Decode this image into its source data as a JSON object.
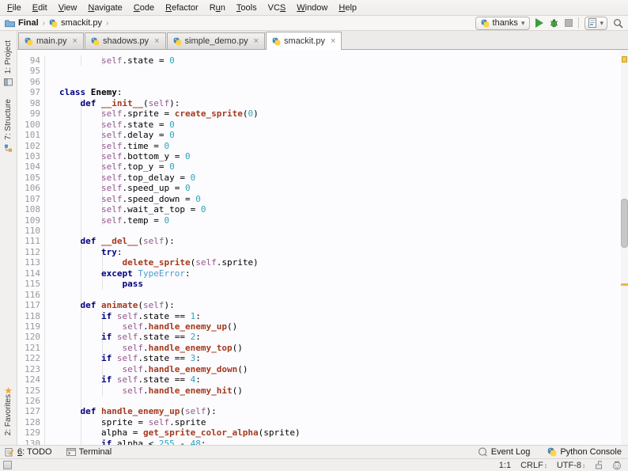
{
  "menu": {
    "items": [
      {
        "label": "File",
        "m": 0
      },
      {
        "label": "Edit",
        "m": 0
      },
      {
        "label": "View",
        "m": 0
      },
      {
        "label": "Navigate",
        "m": 0
      },
      {
        "label": "Code",
        "m": 0
      },
      {
        "label": "Refactor",
        "m": 0
      },
      {
        "label": "Run",
        "m": 1
      },
      {
        "label": "Tools",
        "m": 0
      },
      {
        "label": "VCS",
        "m": 2
      },
      {
        "label": "Window",
        "m": 0
      },
      {
        "label": "Help",
        "m": 0
      }
    ]
  },
  "breadcrumb": {
    "items": [
      {
        "label": "Final",
        "icon": "folder-icon",
        "bold": true
      },
      {
        "label": "smackit.py",
        "icon": "python-file-icon",
        "bold": false
      }
    ]
  },
  "toolbar": {
    "run_config_label": "thanks"
  },
  "tabs": [
    {
      "label": "main.py",
      "icon": "python-file-icon",
      "close": "×",
      "active": false
    },
    {
      "label": "shadows.py",
      "icon": "python-file-icon",
      "close": "×",
      "active": false
    },
    {
      "label": "simple_demo.py",
      "icon": "python-file-icon",
      "close": "×",
      "active": false
    },
    {
      "label": "smackit.py",
      "icon": "python-file-icon",
      "close": "×",
      "active": true
    }
  ],
  "left_stripe": {
    "project": "1: Project",
    "structure": "7: Structure",
    "favorites": "2: Favorites"
  },
  "colors": {
    "keyword": "#000080",
    "self": "#94558D",
    "function": "#A5391E",
    "number": "#2EA3BE",
    "exception": "#4C9CC9",
    "warn_stripe": "#F5C944"
  },
  "editor": {
    "lines": [
      {
        "n": 94,
        "t": [
          [
            "p",
            "        "
          ],
          [
            "s",
            "self"
          ],
          [
            "p",
            ".state = "
          ],
          [
            "n",
            "0"
          ]
        ]
      },
      {
        "n": 95,
        "t": []
      },
      {
        "n": 96,
        "t": []
      },
      {
        "n": 97,
        "t": [
          [
            "k",
            "class "
          ],
          [
            "c",
            "Enemy"
          ],
          [
            "p",
            ":"
          ]
        ]
      },
      {
        "n": 98,
        "t": [
          [
            "p",
            "    "
          ],
          [
            "k",
            "def "
          ],
          [
            "f",
            "__init__"
          ],
          [
            "p",
            "("
          ],
          [
            "s",
            "self"
          ],
          [
            "p",
            "):"
          ]
        ]
      },
      {
        "n": 99,
        "t": [
          [
            "p",
            "        "
          ],
          [
            "s",
            "self"
          ],
          [
            "p",
            ".sprite = "
          ],
          [
            "f",
            "create_sprite"
          ],
          [
            "p",
            "("
          ],
          [
            "n",
            "0"
          ],
          [
            "p",
            ")"
          ]
        ]
      },
      {
        "n": 100,
        "t": [
          [
            "p",
            "        "
          ],
          [
            "s",
            "self"
          ],
          [
            "p",
            ".state = "
          ],
          [
            "n",
            "0"
          ]
        ]
      },
      {
        "n": 101,
        "t": [
          [
            "p",
            "        "
          ],
          [
            "s",
            "self"
          ],
          [
            "p",
            ".delay = "
          ],
          [
            "n",
            "0"
          ]
        ]
      },
      {
        "n": 102,
        "t": [
          [
            "p",
            "        "
          ],
          [
            "s",
            "self"
          ],
          [
            "p",
            ".time = "
          ],
          [
            "n",
            "0"
          ]
        ]
      },
      {
        "n": 103,
        "t": [
          [
            "p",
            "        "
          ],
          [
            "s",
            "self"
          ],
          [
            "p",
            ".bottom_y = "
          ],
          [
            "n",
            "0"
          ]
        ]
      },
      {
        "n": 104,
        "t": [
          [
            "p",
            "        "
          ],
          [
            "s",
            "self"
          ],
          [
            "p",
            ".top_y = "
          ],
          [
            "n",
            "0"
          ]
        ]
      },
      {
        "n": 105,
        "t": [
          [
            "p",
            "        "
          ],
          [
            "s",
            "self"
          ],
          [
            "p",
            ".top_delay = "
          ],
          [
            "n",
            "0"
          ]
        ]
      },
      {
        "n": 106,
        "t": [
          [
            "p",
            "        "
          ],
          [
            "s",
            "self"
          ],
          [
            "p",
            ".speed_up = "
          ],
          [
            "n",
            "0"
          ]
        ]
      },
      {
        "n": 107,
        "t": [
          [
            "p",
            "        "
          ],
          [
            "s",
            "self"
          ],
          [
            "p",
            ".speed_down = "
          ],
          [
            "n",
            "0"
          ]
        ]
      },
      {
        "n": 108,
        "t": [
          [
            "p",
            "        "
          ],
          [
            "s",
            "self"
          ],
          [
            "p",
            ".wait_at_top = "
          ],
          [
            "n",
            "0"
          ]
        ]
      },
      {
        "n": 109,
        "t": [
          [
            "p",
            "        "
          ],
          [
            "s",
            "self"
          ],
          [
            "p",
            ".temp = "
          ],
          [
            "n",
            "0"
          ]
        ]
      },
      {
        "n": 110,
        "t": []
      },
      {
        "n": 111,
        "t": [
          [
            "p",
            "    "
          ],
          [
            "k",
            "def "
          ],
          [
            "f",
            "__del__"
          ],
          [
            "p",
            "("
          ],
          [
            "s",
            "self"
          ],
          [
            "p",
            "):"
          ]
        ]
      },
      {
        "n": 112,
        "t": [
          [
            "p",
            "        "
          ],
          [
            "k",
            "try"
          ],
          [
            "p",
            ":"
          ]
        ]
      },
      {
        "n": 113,
        "t": [
          [
            "p",
            "            "
          ],
          [
            "f",
            "delete_sprite"
          ],
          [
            "p",
            "("
          ],
          [
            "s",
            "self"
          ],
          [
            "p",
            ".sprite)"
          ]
        ]
      },
      {
        "n": 114,
        "t": [
          [
            "p",
            "        "
          ],
          [
            "k",
            "except "
          ],
          [
            "e",
            "TypeError"
          ],
          [
            "p",
            ":"
          ]
        ]
      },
      {
        "n": 115,
        "t": [
          [
            "p",
            "            "
          ],
          [
            "k",
            "pass"
          ]
        ]
      },
      {
        "n": 116,
        "t": []
      },
      {
        "n": 117,
        "t": [
          [
            "p",
            "    "
          ],
          [
            "k",
            "def "
          ],
          [
            "f",
            "animate"
          ],
          [
            "p",
            "("
          ],
          [
            "s",
            "self"
          ],
          [
            "p",
            "):"
          ]
        ]
      },
      {
        "n": 118,
        "t": [
          [
            "p",
            "        "
          ],
          [
            "k",
            "if "
          ],
          [
            "s",
            "self"
          ],
          [
            "p",
            ".state == "
          ],
          [
            "n",
            "1"
          ],
          [
            "p",
            ":"
          ]
        ]
      },
      {
        "n": 119,
        "t": [
          [
            "p",
            "            "
          ],
          [
            "s",
            "self"
          ],
          [
            "p",
            "."
          ],
          [
            "f",
            "handle_enemy_up"
          ],
          [
            "p",
            "()"
          ]
        ]
      },
      {
        "n": 120,
        "t": [
          [
            "p",
            "        "
          ],
          [
            "k",
            "if "
          ],
          [
            "s",
            "self"
          ],
          [
            "p",
            ".state == "
          ],
          [
            "n",
            "2"
          ],
          [
            "p",
            ":"
          ]
        ]
      },
      {
        "n": 121,
        "t": [
          [
            "p",
            "            "
          ],
          [
            "s",
            "self"
          ],
          [
            "p",
            "."
          ],
          [
            "f",
            "handle_enemy_top"
          ],
          [
            "p",
            "()"
          ]
        ]
      },
      {
        "n": 122,
        "t": [
          [
            "p",
            "        "
          ],
          [
            "k",
            "if "
          ],
          [
            "s",
            "self"
          ],
          [
            "p",
            ".state == "
          ],
          [
            "n",
            "3"
          ],
          [
            "p",
            ":"
          ]
        ]
      },
      {
        "n": 123,
        "t": [
          [
            "p",
            "            "
          ],
          [
            "s",
            "self"
          ],
          [
            "p",
            "."
          ],
          [
            "f",
            "handle_enemy_down"
          ],
          [
            "p",
            "()"
          ]
        ]
      },
      {
        "n": 124,
        "t": [
          [
            "p",
            "        "
          ],
          [
            "k",
            "if "
          ],
          [
            "s",
            "self"
          ],
          [
            "p",
            ".state == "
          ],
          [
            "n",
            "4"
          ],
          [
            "p",
            ":"
          ]
        ]
      },
      {
        "n": 125,
        "t": [
          [
            "p",
            "            "
          ],
          [
            "s",
            "self"
          ],
          [
            "p",
            "."
          ],
          [
            "f",
            "handle_enemy_hit"
          ],
          [
            "p",
            "()"
          ]
        ]
      },
      {
        "n": 126,
        "t": []
      },
      {
        "n": 127,
        "t": [
          [
            "p",
            "    "
          ],
          [
            "k",
            "def "
          ],
          [
            "f",
            "handle_enemy_up"
          ],
          [
            "p",
            "("
          ],
          [
            "s",
            "self"
          ],
          [
            "p",
            "):"
          ]
        ]
      },
      {
        "n": 128,
        "t": [
          [
            "p",
            "        sprite = "
          ],
          [
            "s",
            "self"
          ],
          [
            "p",
            ".sprite"
          ]
        ]
      },
      {
        "n": 129,
        "t": [
          [
            "p",
            "        alpha = "
          ],
          [
            "f",
            "get_sprite_color_alpha"
          ],
          [
            "p",
            "(sprite)"
          ]
        ]
      },
      {
        "n": 130,
        "t": [
          [
            "p",
            "        "
          ],
          [
            "k",
            "if "
          ],
          [
            "p",
            "alpha < "
          ],
          [
            "n",
            "255"
          ],
          [
            "p",
            " - "
          ],
          [
            "n",
            "48"
          ],
          [
            "p",
            ":"
          ]
        ]
      }
    ]
  },
  "bottom_bar": {
    "todo": {
      "label": "6: TODO",
      "m": 0
    },
    "terminal": {
      "label": "Terminal",
      "m": -1
    },
    "event_log": "Event Log",
    "python_console": "Python Console"
  },
  "status_bar": {
    "caret": "1:1",
    "line_ending": "CRLF",
    "encoding": "UTF-8"
  }
}
